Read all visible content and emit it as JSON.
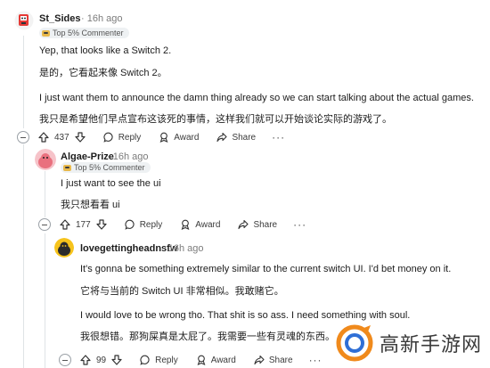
{
  "comments": [
    {
      "username": "St_Sides",
      "time": "16h ago",
      "badge": "Top 5% Commenter",
      "lines": [
        "Yep, that looks like a Switch 2.",
        "是的，它看起来像 Switch 2。",
        "I just want them to announce the damn thing already so we can start talking about the actual games.",
        "我只是希望他们早点宣布这该死的事情，这样我们就可以开始谈论实际的游戏了。"
      ],
      "score": "437",
      "reply_label": "Reply",
      "award_label": "Award",
      "share_label": "Share",
      "more_label": "···"
    },
    {
      "username": "Algae-Prize",
      "time": "16h ago",
      "badge": "Top 5% Commenter",
      "lines": [
        "I just want to see the ui",
        "我只想看看 ui"
      ],
      "score": "177",
      "reply_label": "Reply",
      "award_label": "Award",
      "share_label": "Share",
      "more_label": "···"
    },
    {
      "username": "lovegettingheadnsfw",
      "time": "16h ago",
      "lines": [
        "It's gonna be something extremely similar to the current switch UI. I'd bet money on it.",
        "它将与当前的 Switch UI 非常相似。我敢赌它。",
        "I would love to be wrong tho. That shit is so ass. I need something with soul.",
        "我很想错。那狗屎真是太屁了。我需要一些有灵魂的东西。"
      ],
      "score": "99",
      "reply_label": "Reply",
      "award_label": "Award",
      "share_label": "Share",
      "more_label": "···"
    }
  ],
  "separator": "·",
  "watermark": {
    "text": "高新手游网"
  },
  "colors": {
    "accent": "#ff4500",
    "badge_bg": "#eef1f3",
    "thread_line": "#dfe3e6",
    "watermark_orange": "#f08a1c"
  }
}
